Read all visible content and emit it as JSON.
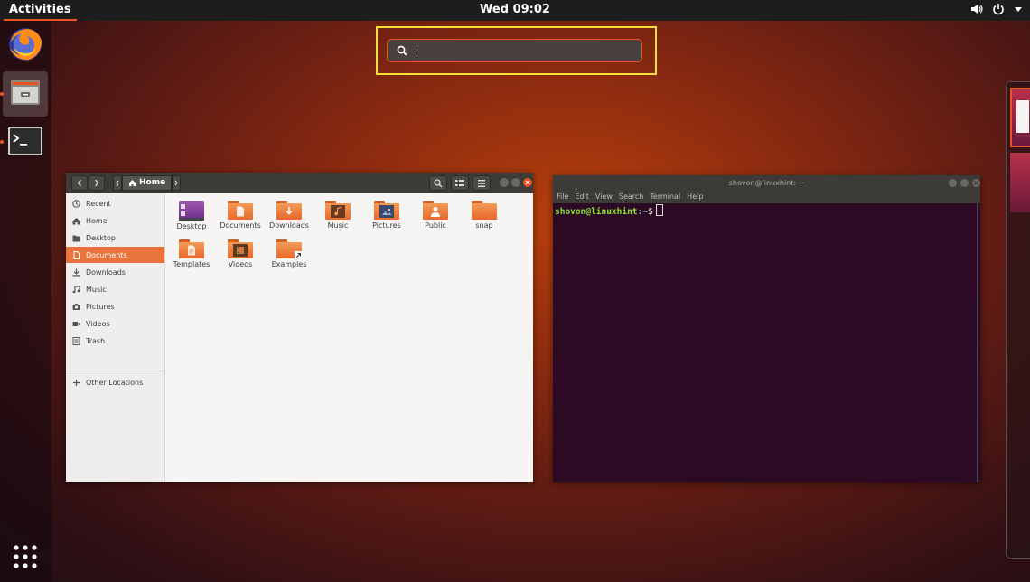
{
  "topbar": {
    "activities": "Activities",
    "clock": "Wed 09:02",
    "tray_icons": [
      "volume-icon",
      "power-icon",
      "menu-arrow-icon"
    ]
  },
  "dock": {
    "apps": [
      {
        "name": "Firefox",
        "icon": "firefox-icon",
        "running": false
      },
      {
        "name": "Files",
        "icon": "files-icon",
        "running": true,
        "active": true
      },
      {
        "name": "Terminal",
        "icon": "terminal-icon",
        "running": true
      }
    ],
    "show_apps_icon": "app-grid-icon"
  },
  "search": {
    "value": "",
    "icon": "search-icon",
    "highlight_color": "#f3e03a",
    "accent_color": "#e95420"
  },
  "files_window": {
    "path": [
      "Home"
    ],
    "sidebar": [
      {
        "label": "Recent",
        "icon": "clock-icon"
      },
      {
        "label": "Home",
        "icon": "home-icon"
      },
      {
        "label": "Desktop",
        "icon": "desktop-icon"
      },
      {
        "label": "Documents",
        "icon": "document-icon",
        "selected": true
      },
      {
        "label": "Downloads",
        "icon": "download-icon"
      },
      {
        "label": "Music",
        "icon": "music-icon"
      },
      {
        "label": "Pictures",
        "icon": "camera-icon"
      },
      {
        "label": "Videos",
        "icon": "video-icon"
      },
      {
        "label": "Trash",
        "icon": "trash-icon"
      }
    ],
    "other_locations": "Other Locations",
    "folders": [
      {
        "label": "Desktop"
      },
      {
        "label": "Documents"
      },
      {
        "label": "Downloads"
      },
      {
        "label": "Music"
      },
      {
        "label": "Pictures"
      },
      {
        "label": "Public"
      },
      {
        "label": "snap"
      },
      {
        "label": "Templates"
      },
      {
        "label": "Videos"
      },
      {
        "label": "Examples"
      }
    ]
  },
  "terminal_window": {
    "title": "shovon@linuxhint: ~",
    "menu": [
      "File",
      "Edit",
      "View",
      "Search",
      "Terminal",
      "Help"
    ],
    "prompt_user": "shovon@linuxhint",
    "prompt_path": ":~",
    "prompt_symbol": "$"
  }
}
